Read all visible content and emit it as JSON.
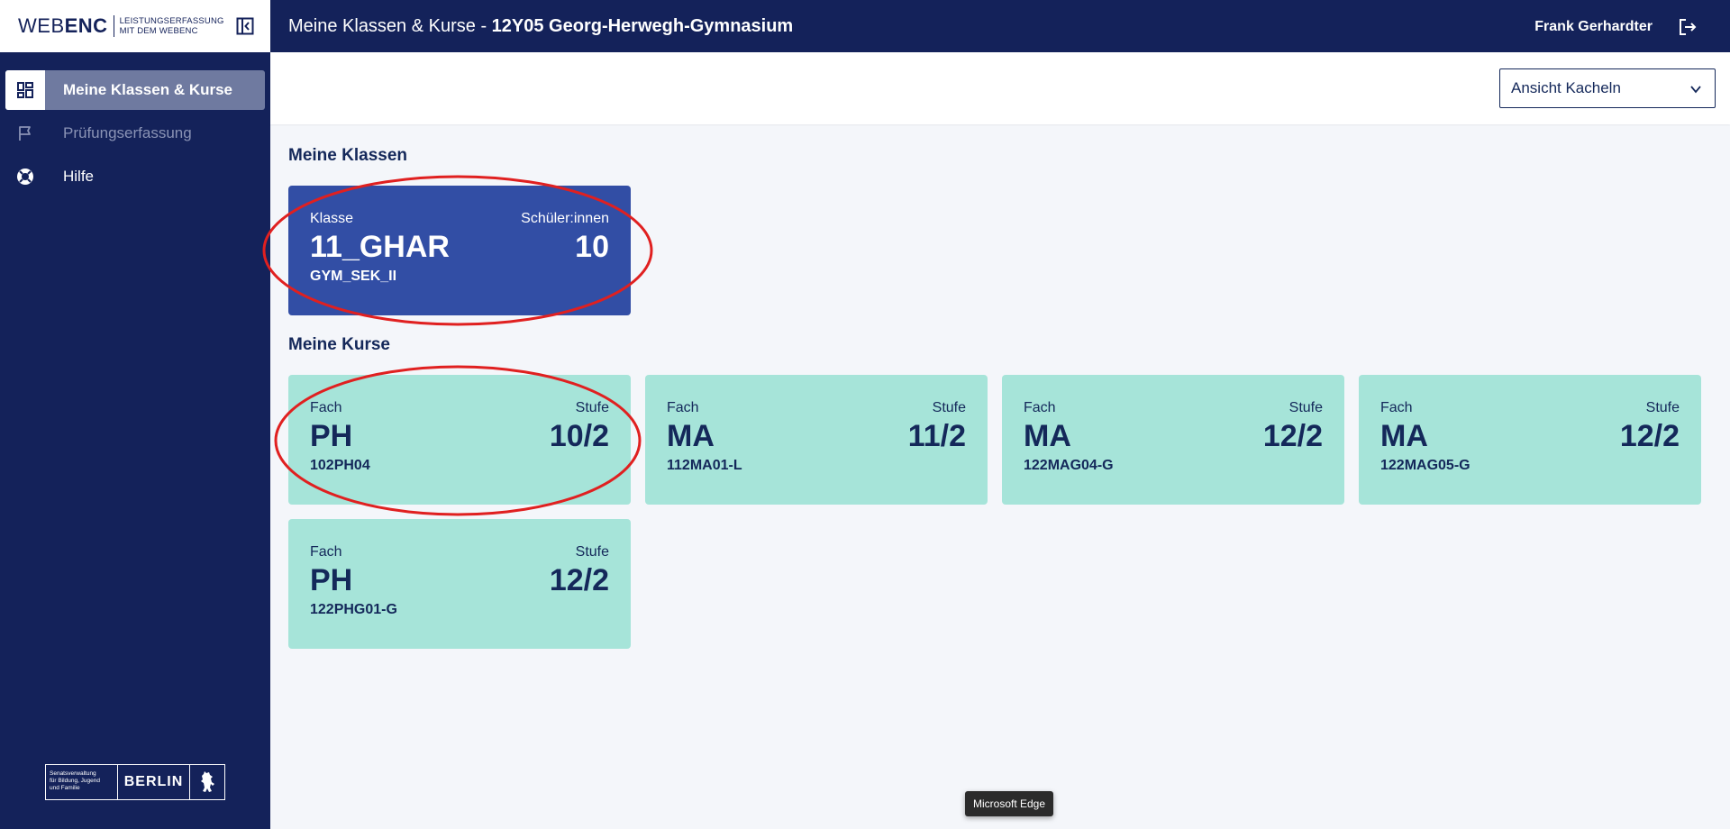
{
  "app": {
    "logo_main_a": "WEB",
    "logo_main_b": "ENC",
    "logo_sub_line1": "LEISTUNGSERFASSUNG",
    "logo_sub_line2": "MIT DEM WEBENC"
  },
  "header": {
    "title_prefix": "Meine Klassen & Kurse - ",
    "title_school": "12Y05 Georg-Herwegh-Gymnasium",
    "user_name": "Frank Gerhardter"
  },
  "sidebar": {
    "items": [
      {
        "label": "Meine Klassen & Kurse",
        "icon": "dashboard-icon",
        "state": "active"
      },
      {
        "label": "Prüfungserfassung",
        "icon": "flag-icon",
        "state": "disabled"
      },
      {
        "label": "Hilfe",
        "icon": "lifebuoy-icon",
        "state": "normal"
      }
    ],
    "footer": {
      "small_line1": "Senatsverwaltung",
      "small_line2": "für Bildung, Jugend",
      "small_line3": "und Familie",
      "city": "BERLIN"
    }
  },
  "toolbar": {
    "view_select_value": "Ansicht Kacheln"
  },
  "sections": {
    "klassen_title": "Meine Klassen",
    "kurse_title": "Meine Kurse"
  },
  "klassen": [
    {
      "label_left": "Klasse",
      "label_right": "Schüler:innen",
      "name": "11_GHAR",
      "count": "10",
      "code": "GYM_SEK_II"
    }
  ],
  "kurse": [
    {
      "label_left": "Fach",
      "label_right": "Stufe",
      "subject": "PH",
      "level": "10/2",
      "code": "102PH04"
    },
    {
      "label_left": "Fach",
      "label_right": "Stufe",
      "subject": "MA",
      "level": "11/2",
      "code": "112MA01-L"
    },
    {
      "label_left": "Fach",
      "label_right": "Stufe",
      "subject": "MA",
      "level": "12/2",
      "code": "122MAG04-G"
    },
    {
      "label_left": "Fach",
      "label_right": "Stufe",
      "subject": "MA",
      "level": "12/2",
      "code": "122MAG05-G"
    },
    {
      "label_left": "Fach",
      "label_right": "Stufe",
      "subject": "PH",
      "level": "12/2",
      "code": "122PHG01-G"
    }
  ],
  "tooltip": {
    "text": "Microsoft Edge"
  },
  "colors": {
    "navy": "#14225a",
    "klasse_card": "#324ea5",
    "kurs_card": "#a6e4d9",
    "annotation_red": "#e02020"
  }
}
